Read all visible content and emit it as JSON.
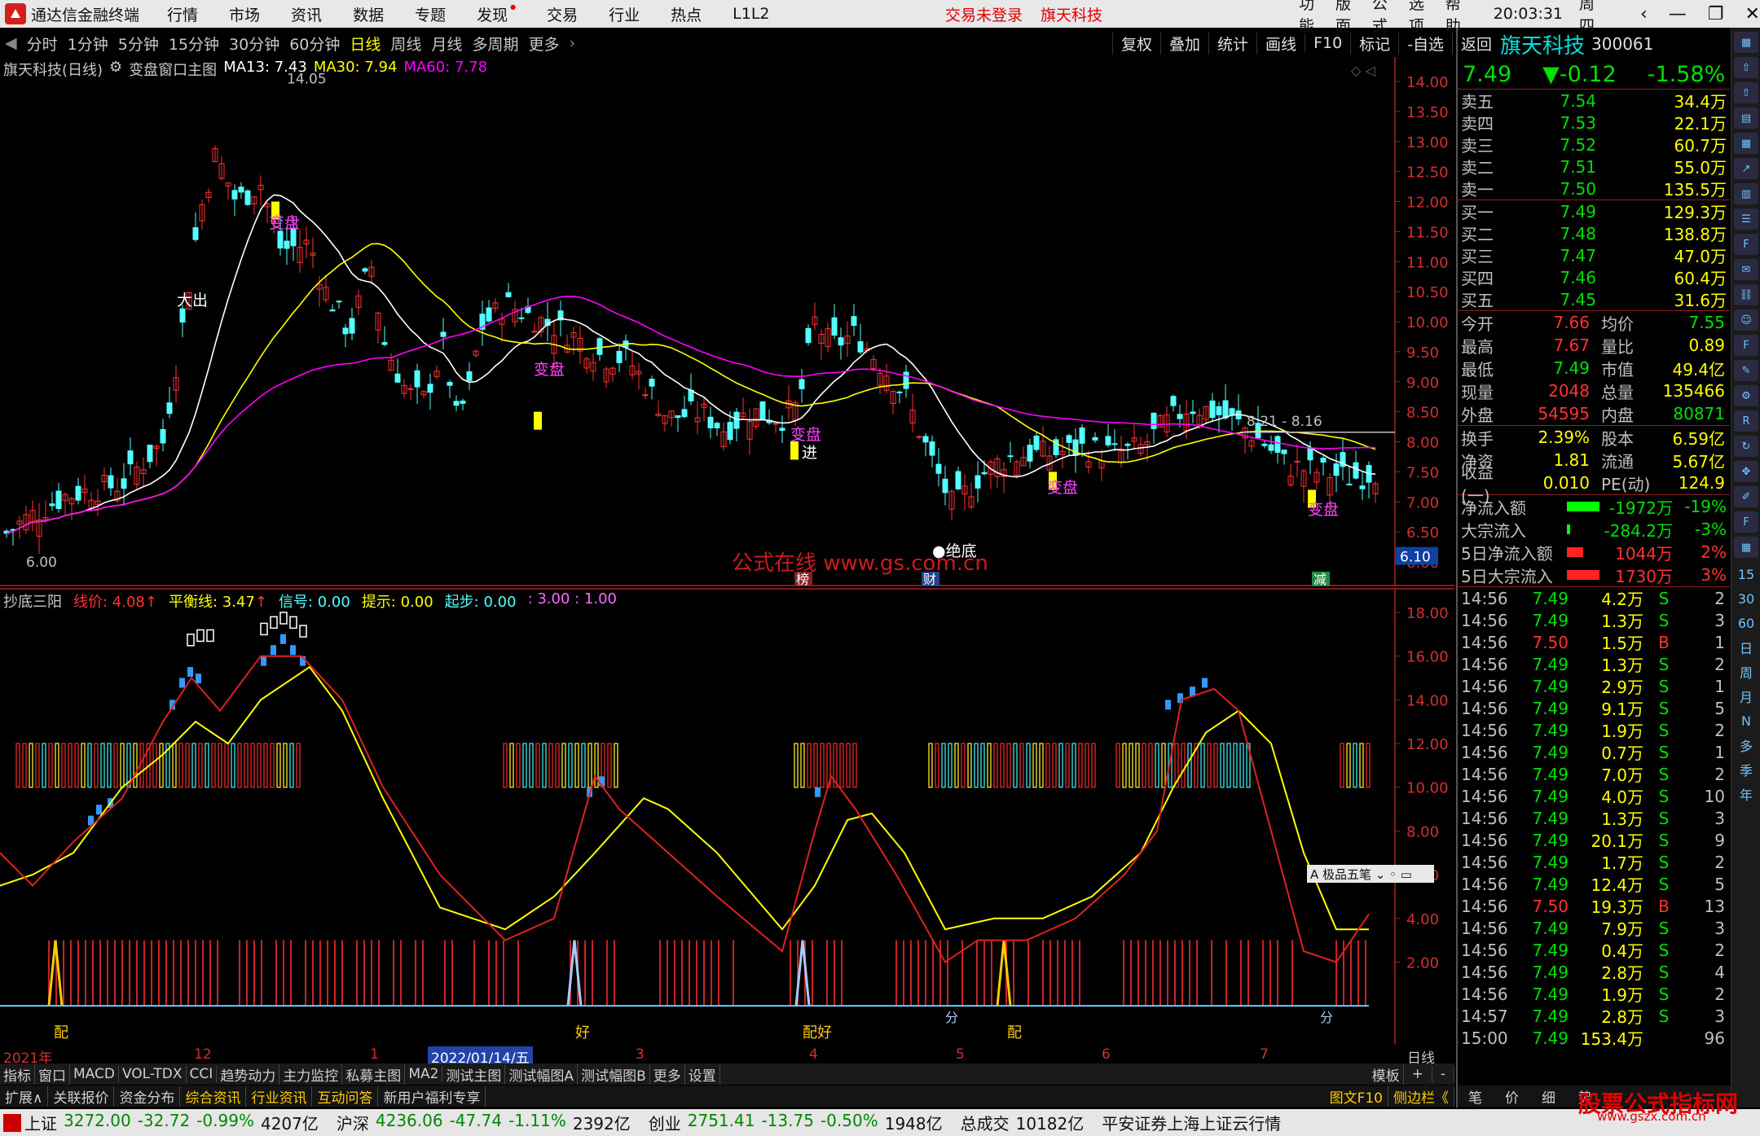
{
  "app": {
    "title": "通达信金融终端",
    "menu": [
      "行情",
      "市场",
      "资讯",
      "数据",
      "专题",
      "发现",
      "交易",
      "行业",
      "热点",
      "L1L2"
    ],
    "login_status": "交易未登录",
    "stock_center": "旗天科技",
    "right_menu": [
      "功能",
      "版面",
      "公式",
      "选项",
      "帮助"
    ],
    "time": "20:03:31",
    "weekday": "周四"
  },
  "periods": [
    "分时",
    "1分钟",
    "5分钟",
    "15分钟",
    "30分钟",
    "60分钟",
    "日线",
    "周线",
    "月线",
    "多周期",
    "更多"
  ],
  "active_period": "日线",
  "tools": [
    "复权",
    "叠加",
    "统计",
    "画线",
    "F10",
    "标记",
    "-自选",
    "返回"
  ],
  "main": {
    "title": "旗天科技(日线)",
    "formula": "变盘窗口主图",
    "ma13": "MA13: 7.43",
    "ma30": "MA30: 7.94",
    "ma60": "MA60: 7.78",
    "high_label": "14.05",
    "low_label": "6.00",
    "range_label": "8.21 - 8.16",
    "price_tag": "6.10",
    "y_ticks": [
      "14.00",
      "13.50",
      "13.00",
      "12.50",
      "12.00",
      "11.50",
      "11.00",
      "10.50",
      "10.00",
      "9.50",
      "9.00",
      "8.50",
      "8.00",
      "7.50",
      "7.00",
      "6.50",
      "6.00"
    ],
    "annotations": {
      "bianpan": "变盘",
      "dachu": "大出",
      "jin": "进",
      "juedi": "绝底",
      "bang": "榜",
      "cai": "财",
      "jian": "减"
    },
    "watermark": "公式在线 www.gs.com.cn"
  },
  "indicator": {
    "name": "抄底三阳",
    "line": "线价: 4.08",
    "line_arrow": "↑",
    "balance": "平衡线: 3.47",
    "balance_arrow": "↑",
    "signal": "信号: 0.00",
    "hint": "提示: 0.00",
    "start": "起步: 0.00",
    "extra": ": 3.00 : 1.00",
    "y_ticks": [
      "18.00",
      "16.00",
      "14.00",
      "12.00",
      "10.00",
      "8.00",
      "6.00",
      "4.00",
      "2.00"
    ],
    "labels": {
      "pei": "配",
      "hao": "好",
      "peihao": "配好",
      "fen": "分"
    },
    "popup": "A 极品五笔 ⌄ ◦ ▭"
  },
  "dates": [
    "2021年",
    "12",
    "2022/01/14/五",
    "1",
    "3",
    "4",
    "5",
    "6",
    "7",
    "日线"
  ],
  "tabs1": [
    "指标",
    "窗口",
    "MACD",
    "VOL-TDX",
    "CCI",
    "趋势动力",
    "主力监控",
    "私募主图",
    "MA2",
    "测试主图",
    "测试幅图A",
    "测试幅图B",
    "更多",
    "设置"
  ],
  "tabs1_right": [
    "模板",
    "+",
    "-"
  ],
  "tabs2": [
    "扩展∧",
    "关联报价",
    "资金分布",
    "综合资讯",
    "行业资讯",
    "互动问答",
    "新用户福利专享"
  ],
  "tabs2_right": [
    "图文F10",
    "侧边栏《",
    "笔",
    "价",
    "细",
    "势"
  ],
  "quote": {
    "name": "旗天科技",
    "code": "300061",
    "price": "7.49",
    "change": "▼-0.12",
    "pct": "-1.58%",
    "asks": [
      [
        "卖五",
        "7.54",
        "34.4万"
      ],
      [
        "卖四",
        "7.53",
        "22.1万"
      ],
      [
        "卖三",
        "7.52",
        "60.7万"
      ],
      [
        "卖二",
        "7.51",
        "55.0万"
      ],
      [
        "卖一",
        "7.50",
        "135.5万"
      ]
    ],
    "bids": [
      [
        "买一",
        "7.49",
        "129.3万"
      ],
      [
        "买二",
        "7.48",
        "138.8万"
      ],
      [
        "买三",
        "7.47",
        "47.0万"
      ],
      [
        "买四",
        "7.46",
        "60.4万"
      ],
      [
        "买五",
        "7.45",
        "31.6万"
      ]
    ],
    "stats": [
      [
        "今开",
        "7.66",
        "均价",
        "7.55"
      ],
      [
        "最高",
        "7.67",
        "量比",
        "0.89"
      ],
      [
        "最低",
        "7.49",
        "市值",
        "49.4亿"
      ],
      [
        "现量",
        "2048",
        "总量",
        "135466"
      ],
      [
        "外盘",
        "54595",
        "内盘",
        "80871"
      ]
    ],
    "stats2": [
      [
        "换手",
        "2.39%",
        "股本",
        "6.59亿"
      ],
      [
        "净资",
        "1.81",
        "流通",
        "5.67亿"
      ],
      [
        "收益(一)",
        "0.010",
        "PE(动)",
        "124.9"
      ]
    ],
    "flows": [
      [
        "净流入额",
        "-1972万",
        "-19%"
      ],
      [
        "大宗流入",
        "-284.2万",
        "-3%"
      ],
      [
        "5日净流入额",
        "1044万",
        "2%"
      ],
      [
        "5日大宗流入",
        "1730万",
        "3%"
      ]
    ],
    "ticks": [
      [
        "14:56",
        "7.49",
        "4.2万",
        "S",
        "2"
      ],
      [
        "14:56",
        "7.49",
        "1.3万",
        "S",
        "3"
      ],
      [
        "14:56",
        "7.50",
        "1.5万",
        "B",
        "1"
      ],
      [
        "14:56",
        "7.49",
        "1.3万",
        "S",
        "2"
      ],
      [
        "14:56",
        "7.49",
        "2.9万",
        "S",
        "1"
      ],
      [
        "14:56",
        "7.49",
        "9.1万",
        "S",
        "5"
      ],
      [
        "14:56",
        "7.49",
        "1.9万",
        "S",
        "2"
      ],
      [
        "14:56",
        "7.49",
        "0.7万",
        "S",
        "1"
      ],
      [
        "14:56",
        "7.49",
        "7.0万",
        "S",
        "2"
      ],
      [
        "14:56",
        "7.49",
        "4.0万",
        "S",
        "10"
      ],
      [
        "14:56",
        "7.49",
        "1.3万",
        "S",
        "3"
      ],
      [
        "14:56",
        "7.49",
        "20.1万",
        "S",
        "9"
      ],
      [
        "14:56",
        "7.49",
        "1.7万",
        "S",
        "2"
      ],
      [
        "14:56",
        "7.49",
        "12.4万",
        "S",
        "5"
      ],
      [
        "14:56",
        "7.50",
        "19.3万",
        "B",
        "13"
      ],
      [
        "14:56",
        "7.49",
        "7.9万",
        "S",
        "3"
      ],
      [
        "14:56",
        "7.49",
        "0.4万",
        "S",
        "2"
      ],
      [
        "14:56",
        "7.49",
        "2.8万",
        "S",
        "4"
      ],
      [
        "14:56",
        "7.49",
        "1.9万",
        "S",
        "2"
      ],
      [
        "14:57",
        "7.49",
        "2.8万",
        "S",
        "3"
      ],
      [
        "15:00",
        "7.49",
        "153.4万",
        "",
        "96"
      ]
    ]
  },
  "side_labels": [
    "15",
    "30",
    "60",
    "日",
    "周",
    "月",
    "N",
    "多",
    "季",
    "年"
  ],
  "status": {
    "sh_label": "上证",
    "sh": "3272.00",
    "sh_chg": "-32.72",
    "sh_pct": "-0.99%",
    "sh_amt": "4207亿",
    "hs_label": "沪深",
    "hs": "4236.06",
    "hs_chg": "-47.74",
    "hs_pct": "-1.11%",
    "hs_amt": "2392亿",
    "cy_label": "创业",
    "cy": "2751.41",
    "cy_chg": "-13.75",
    "cy_pct": "-0.50%",
    "cy_amt": "1948亿",
    "total_label": "总成交",
    "total": "10182亿",
    "source": "平安证券上海上证云行情"
  },
  "corner_brand": "股票公式指标网",
  "corner_url": "www.gszx.com.cn",
  "colors": {
    "up": "#ff3232",
    "down": "#54ffff",
    "ma13": "#ffffff",
    "ma30": "#ffff00",
    "ma60": "#ff00ff",
    "price_line": "#dd2222",
    "balance_line": "#ffff00"
  }
}
